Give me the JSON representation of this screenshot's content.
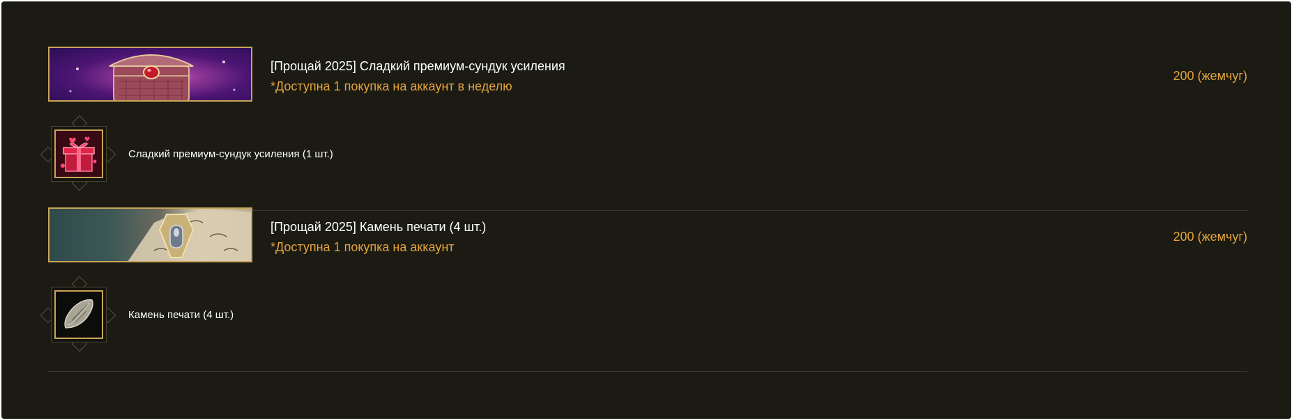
{
  "products": [
    {
      "title": "[Прощай 2025] Сладкий премиум-сундук усиления",
      "limit": "*Доступна 1 покупка на аккаунт в неделю",
      "price": "200 (жемчуг)",
      "reward_name": "Сладкий премиум-сундук усиления (1 шт.)",
      "banner_icon": "premium-chest-icon",
      "reward_icon": "gift-box-icon"
    },
    {
      "title": "[Прощай 2025] Камень печати (4 шт.)",
      "limit": "*Доступна 1 покупка на аккаунт",
      "price": "200 (жемчуг)",
      "reward_name": "Камень печати (4 шт.)",
      "banner_icon": "seal-stone-icon",
      "reward_icon": "seal-stone-icon"
    }
  ],
  "colors": {
    "background": "#1b1a13",
    "accent_gold": "#e2a33e",
    "frame_gold": "#c9a55a",
    "text": "#ffffff"
  }
}
